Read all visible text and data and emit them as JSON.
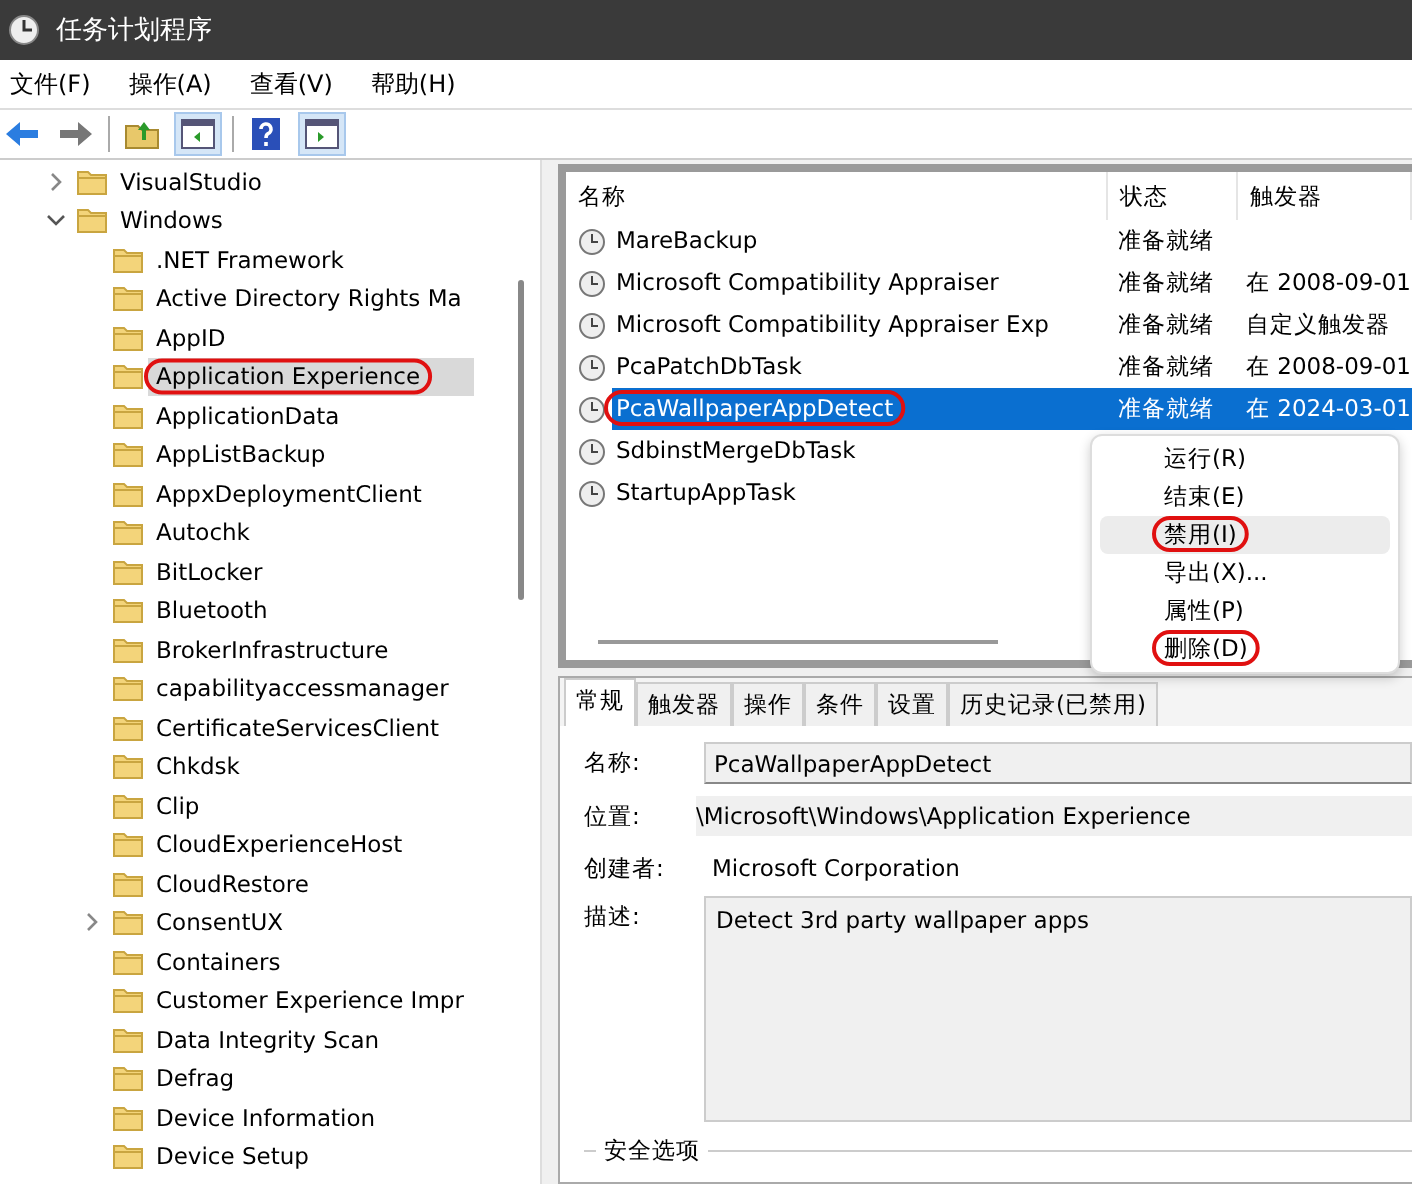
{
  "window": {
    "title": "任务计划程序"
  },
  "menu": [
    "文件(F)",
    "操作(A)",
    "查看(V)",
    "帮助(H)"
  ],
  "tree": [
    {
      "label": "VisualStudio",
      "expanded": false,
      "selected": false,
      "circled": false
    },
    {
      "label": "Windows",
      "expanded": true,
      "selected": false,
      "circled": false,
      "children": [
        {
          "label": ".NET Framework",
          "selected": false,
          "circled": false
        },
        {
          "label": "Active Directory Rights Ma",
          "selected": false,
          "circled": false
        },
        {
          "label": "AppID",
          "selected": false,
          "circled": false
        },
        {
          "label": "Application Experience",
          "selected": true,
          "circled": true
        },
        {
          "label": "ApplicationData",
          "selected": false,
          "circled": false
        },
        {
          "label": "AppListBackup",
          "selected": false,
          "circled": false
        },
        {
          "label": "AppxDeploymentClient",
          "selected": false,
          "circled": false
        },
        {
          "label": "Autochk",
          "selected": false,
          "circled": false
        },
        {
          "label": "BitLocker",
          "selected": false,
          "circled": false
        },
        {
          "label": "Bluetooth",
          "selected": false,
          "circled": false
        },
        {
          "label": "BrokerInfrastructure",
          "selected": false,
          "circled": false
        },
        {
          "label": "capabilityaccessmanager",
          "selected": false,
          "circled": false
        },
        {
          "label": "CertificateServicesClient",
          "selected": false,
          "circled": false
        },
        {
          "label": "Chkdsk",
          "selected": false,
          "circled": false
        },
        {
          "label": "Clip",
          "selected": false,
          "circled": false
        },
        {
          "label": "CloudExperienceHost",
          "selected": false,
          "circled": false
        },
        {
          "label": "CloudRestore",
          "selected": false,
          "circled": false
        },
        {
          "label": "ConsentUX",
          "expanded": false,
          "selected": false,
          "circled": false
        },
        {
          "label": "Containers",
          "selected": false,
          "circled": false
        },
        {
          "label": "Customer Experience Impr",
          "selected": false,
          "circled": false
        },
        {
          "label": "Data Integrity Scan",
          "selected": false,
          "circled": false
        },
        {
          "label": "Defrag",
          "selected": false,
          "circled": false
        },
        {
          "label": "Device Information",
          "selected": false,
          "circled": false
        },
        {
          "label": "Device Setup",
          "selected": false,
          "circled": false
        }
      ]
    }
  ],
  "table": {
    "columns": [
      "名称",
      "状态",
      "触发器"
    ],
    "rows": [
      {
        "name": "MareBackup",
        "status": "准备就绪",
        "trigger": "",
        "selected": false,
        "circled": false
      },
      {
        "name": "Microsoft Compatibility Appraiser",
        "status": "准备就绪",
        "trigger": "在 2008-09-01",
        "selected": false,
        "circled": false
      },
      {
        "name": "Microsoft Compatibility Appraiser Exp",
        "status": "准备就绪",
        "trigger": "自定义触发器",
        "selected": false,
        "circled": false
      },
      {
        "name": "PcaPatchDbTask",
        "status": "准备就绪",
        "trigger": "在 2008-09-01",
        "selected": false,
        "circled": false
      },
      {
        "name": "PcaWallpaperAppDetect",
        "status": "准备就绪",
        "trigger": "在 2024-03-01",
        "selected": true,
        "circled": true
      },
      {
        "name": "SdbinstMergeDbTask",
        "status": "",
        "trigger": "",
        "selected": false,
        "circled": false
      },
      {
        "name": "StartupAppTask",
        "status": "",
        "trigger": "",
        "selected": false,
        "circled": false
      }
    ]
  },
  "context_menu": [
    {
      "label": "运行(R)",
      "selected": false,
      "circled": false
    },
    {
      "label": "结束(E)",
      "selected": false,
      "circled": false
    },
    {
      "label": "禁用(I)",
      "selected": true,
      "circled": true
    },
    {
      "label": "导出(X)...",
      "selected": false,
      "circled": false
    },
    {
      "label": "属性(P)",
      "selected": false,
      "circled": false
    },
    {
      "label": "删除(D)",
      "selected": false,
      "circled": true
    }
  ],
  "tabs": [
    {
      "label": "常规",
      "selected": true
    },
    {
      "label": "触发器",
      "selected": false
    },
    {
      "label": "操作",
      "selected": false
    },
    {
      "label": "条件",
      "selected": false
    },
    {
      "label": "设置",
      "selected": false
    },
    {
      "label": "历史记录(已禁用)",
      "selected": false
    }
  ],
  "details": {
    "name_label": "名称:",
    "name": "PcaWallpaperAppDetect",
    "location_label": "位置:",
    "location": "\\Microsoft\\Windows\\Application Experience",
    "author_label": "创建者:",
    "author": "Microsoft Corporation",
    "description_label": "描述:",
    "description": "Detect 3rd party wallpaper apps",
    "security_group": "安全选项"
  }
}
